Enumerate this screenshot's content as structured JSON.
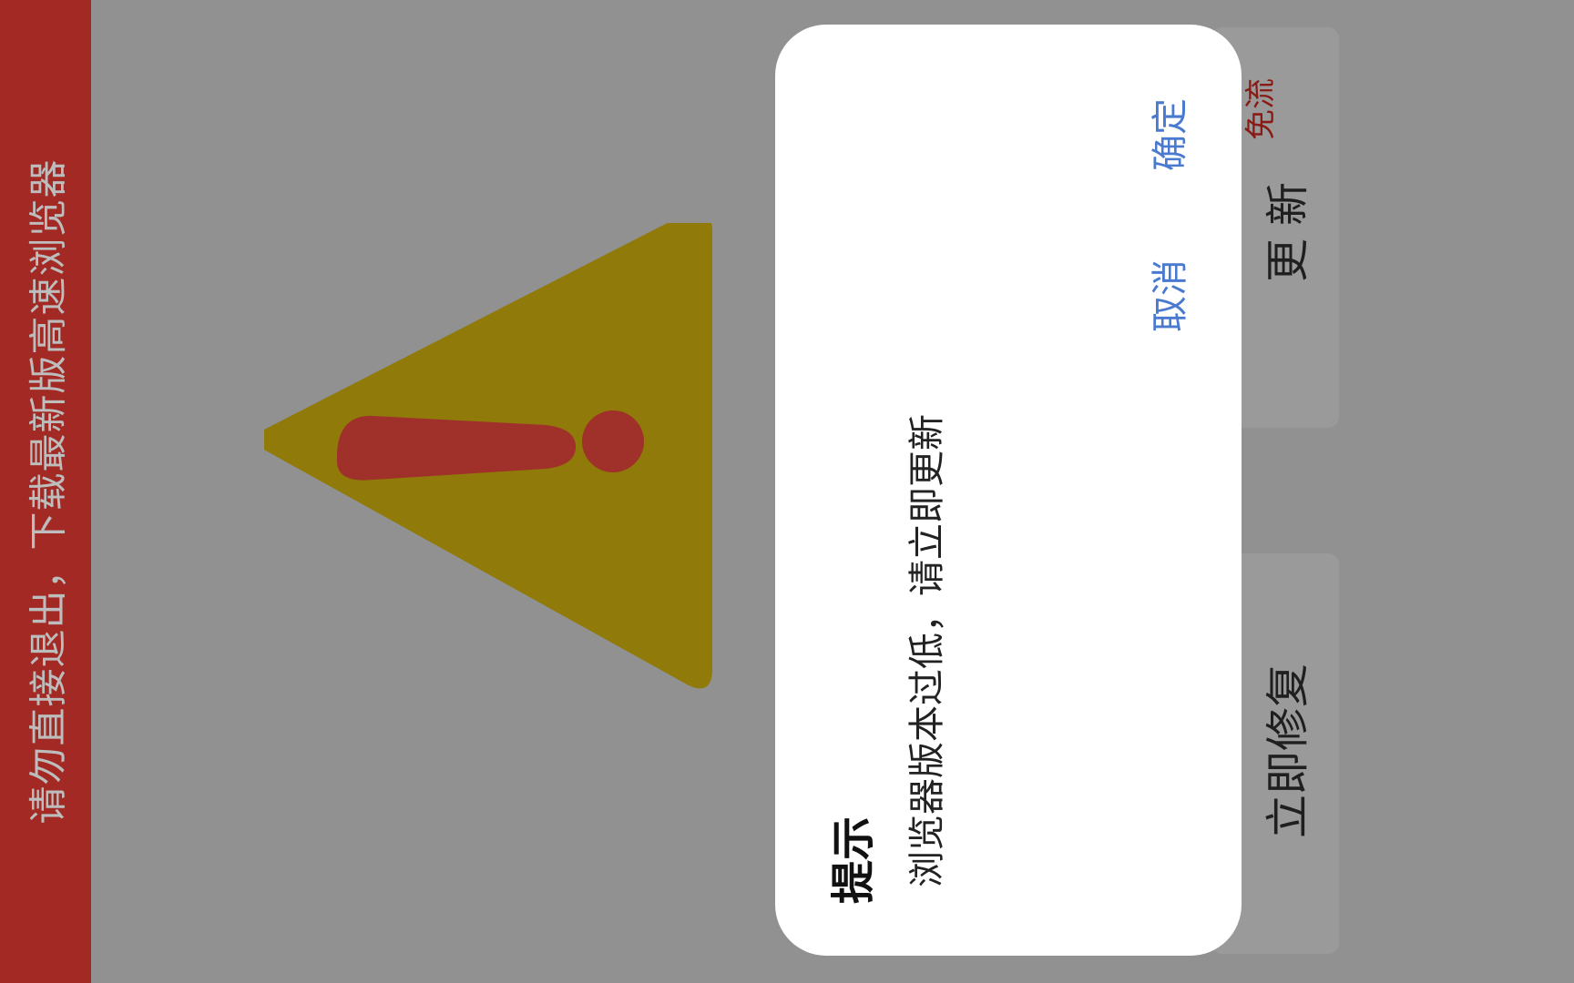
{
  "banner": {
    "text": "请勿直接退出，下载最新版高速浏览器"
  },
  "background_buttons": {
    "update_label": "更新",
    "free_label": "免流",
    "repair_label": "立即修复"
  },
  "dialog": {
    "title": "提示",
    "message": "浏览器版本过低，请立即更新",
    "cancel_label": "取消",
    "confirm_label": "确定"
  },
  "colors": {
    "banner": "#a32a24",
    "overlay": "#919191",
    "triangle": "#8f7a0a",
    "exclamation": "#a0302a",
    "dialog_button_text": "#4a7ad0"
  },
  "icons": {
    "warning": "warning-triangle-icon"
  }
}
